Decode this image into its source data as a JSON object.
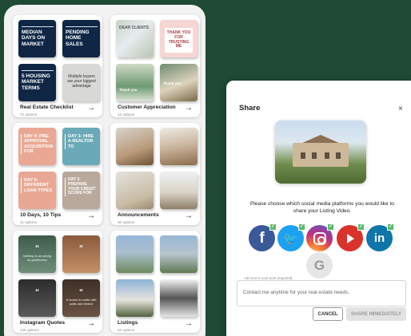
{
  "categories": [
    {
      "name": "Real Estate Checklist",
      "options": "72 options",
      "tiles": [
        "Median Days on Market",
        "Pending Home Sales",
        "5 Housing Market Terms",
        "Multiple buyers are your biggest advantage"
      ]
    },
    {
      "name": "Customer Appreciation",
      "options": "23 options",
      "tiles": [
        "Dear Clients",
        "Thank you for trusting me",
        "Thank you",
        "Thank you"
      ]
    },
    {
      "name": "10 Days, 10 Tips",
      "options": "11 options",
      "tiles": [
        "Day 4: Pre-approval acquisition for",
        "Day 3: Hire a realtor to",
        "Day 5: Different loan types",
        "Day 2: Prepare your credit score for"
      ]
    },
    {
      "name": "Announcements",
      "options": "30 options",
      "tiles": [
        "",
        "",
        "",
        ""
      ]
    },
    {
      "name": "Instagram Quotes",
      "options": "135 options",
      "tiles": [
        "“",
        "“",
        "“",
        "“"
      ],
      "quote_lines": [
        "Nothing is as strong as gentleness",
        "",
        "",
        "A house is made with walls and beams"
      ]
    },
    {
      "name": "Listings",
      "options": "62 options",
      "tiles": [
        "",
        "",
        "",
        ""
      ]
    }
  ],
  "share_dialog": {
    "title": "Share",
    "close_glyph": "×",
    "prompt_line1": "Please choose which social media platforms you would like to",
    "prompt_line2": "share your Listing Video.",
    "platforms": [
      {
        "name": "Facebook",
        "glyph": "f",
        "selected": true,
        "color": "#3b5998"
      },
      {
        "name": "Twitter",
        "glyph": "🐦",
        "selected": true,
        "color": "#1da1f2"
      },
      {
        "name": "Instagram",
        "glyph": "",
        "selected": true,
        "color": "#bc3081"
      },
      {
        "name": "YouTube",
        "glyph": "",
        "selected": true,
        "color": "#d9342b"
      },
      {
        "name": "LinkedIn",
        "glyph": "in",
        "selected": true,
        "color": "#0e76a8"
      },
      {
        "name": "Google",
        "glyph": "G",
        "selected": false,
        "color": "#e6e6e6"
      }
    ],
    "text_field_label": "Add text to your post (required)",
    "text_field_value": "Contact me anytime for your real estate needs.",
    "cancel_label": "CANCEL",
    "share_label": "SHARE IMMEDIATELY",
    "check_glyph": "✓"
  },
  "colors": {
    "background": "#1f4a35",
    "accent_navy": "#0f2645",
    "check_green": "#5dba6b"
  }
}
